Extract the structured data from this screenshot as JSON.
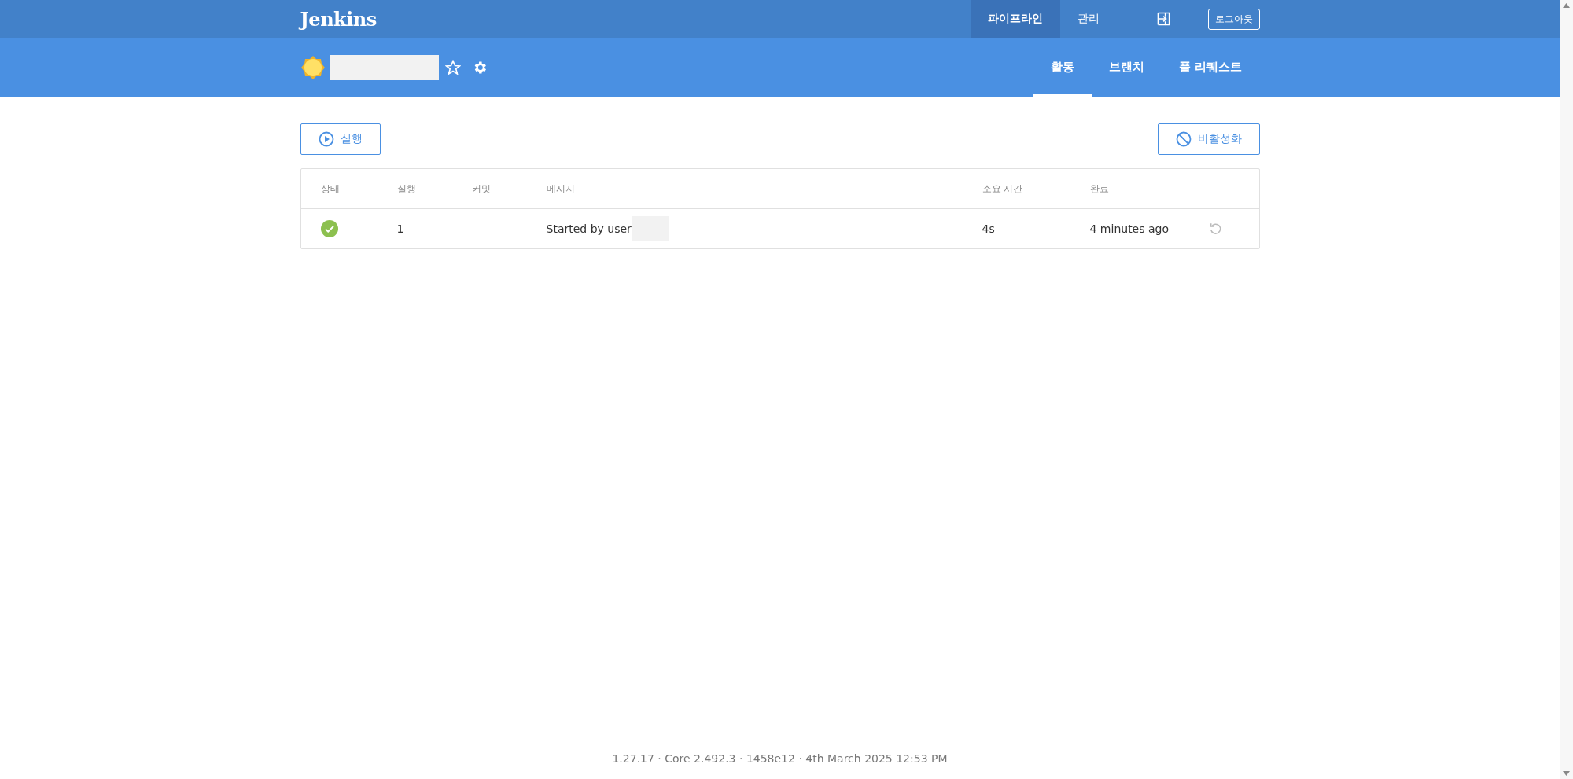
{
  "brand": "Jenkins",
  "top_nav": [
    {
      "label": "파이프라인",
      "selected": true
    },
    {
      "label": "관리",
      "selected": false
    }
  ],
  "logout_button": "로그아웃",
  "pipeline_tabs": [
    {
      "label": "활동",
      "selected": true
    },
    {
      "label": "브랜치",
      "selected": false
    },
    {
      "label": "풀 리퀘스트",
      "selected": false
    }
  ],
  "run_button": "실행",
  "disable_button": "비활성화",
  "table": {
    "columns": [
      "상태",
      "실행",
      "커밋",
      "메시지",
      "소요 시간",
      "완료"
    ],
    "rows": [
      {
        "passed": true,
        "run": "1",
        "commit": "–",
        "message": "Started by user",
        "duration": "4s",
        "completed": "4 minutes ago"
      }
    ]
  },
  "footer": "1.27.17 · Core 2.492.3 · 1458e12 · 4th March 2025 12:53 PM"
}
